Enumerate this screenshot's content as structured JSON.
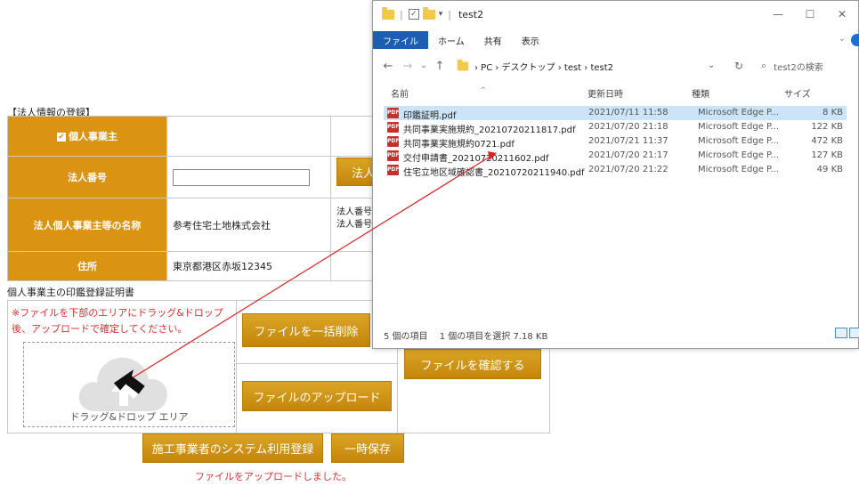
{
  "form": {
    "section_title": "【法人情報の登録】",
    "rows": [
      {
        "label": "個人事業主",
        "value": ""
      },
      {
        "label": "法人番号",
        "value": ""
      },
      {
        "label": "法人個人事業主等の名称",
        "value": "参考住宅土地株式会社"
      },
      {
        "label": "住所",
        "value": "東京都港区赤坂12345"
      }
    ],
    "corp_button_label": "法人",
    "corp_note_line1": "法人番号",
    "corp_note_line2": "法人番号",
    "checkbox_checked": true
  },
  "upload": {
    "title": "個人事業主の印鑑登録証明書",
    "note": "※ファイルを下部のエリアにドラッグ&ドロップ後、アップロードで確定してください。",
    "drop_label": "ドラッグ&ドロップ エリア",
    "delete_all_label": "ファイルを一括削除",
    "upload_label": "ファイルのアップロード",
    "confirm_label": "ファイルを確認する"
  },
  "actions": {
    "register_label": "施工事業者のシステム利用登録",
    "temp_save_label": "一時保存",
    "success_message": "ファイルをアップロードしました。"
  },
  "explorer": {
    "title": "test2",
    "ribbon_tabs": [
      "ファイル",
      "ホーム",
      "共有",
      "表示"
    ],
    "breadcrumb": "› PC › デスクトップ › test › test2",
    "search_placeholder": "test2の検索",
    "columns": {
      "name": "名前",
      "date": "更新日時",
      "type": "種類",
      "size": "サイズ"
    },
    "files": [
      {
        "name": "印鑑証明.pdf",
        "date": "2021/07/11 11:58",
        "type": "Microsoft Edge P...",
        "size": "8 KB",
        "selected": true
      },
      {
        "name": "共同事業実施規約_20210720211817.pdf",
        "date": "2021/07/20 21:18",
        "type": "Microsoft Edge P...",
        "size": "122 KB",
        "selected": false
      },
      {
        "name": "共同事業実施規約0721.pdf",
        "date": "2021/07/21 11:37",
        "type": "Microsoft Edge P...",
        "size": "472 KB",
        "selected": false
      },
      {
        "name": "交付申請書_20210720211602.pdf",
        "date": "2021/07/20 21:17",
        "type": "Microsoft Edge P...",
        "size": "127 KB",
        "selected": false
      },
      {
        "name": "住宅立地区域確認書_20210720211940.pdf",
        "date": "2021/07/20 21:22",
        "type": "Microsoft Edge P...",
        "size": "49 KB",
        "selected": false
      }
    ],
    "status": "5 個の項目　 1 個の項目を選択  7.18 KB"
  },
  "colors": {
    "accent": "#da9412",
    "error": "#e03030",
    "win_accent": "#1a5fb4",
    "selection": "#cce4f7"
  }
}
